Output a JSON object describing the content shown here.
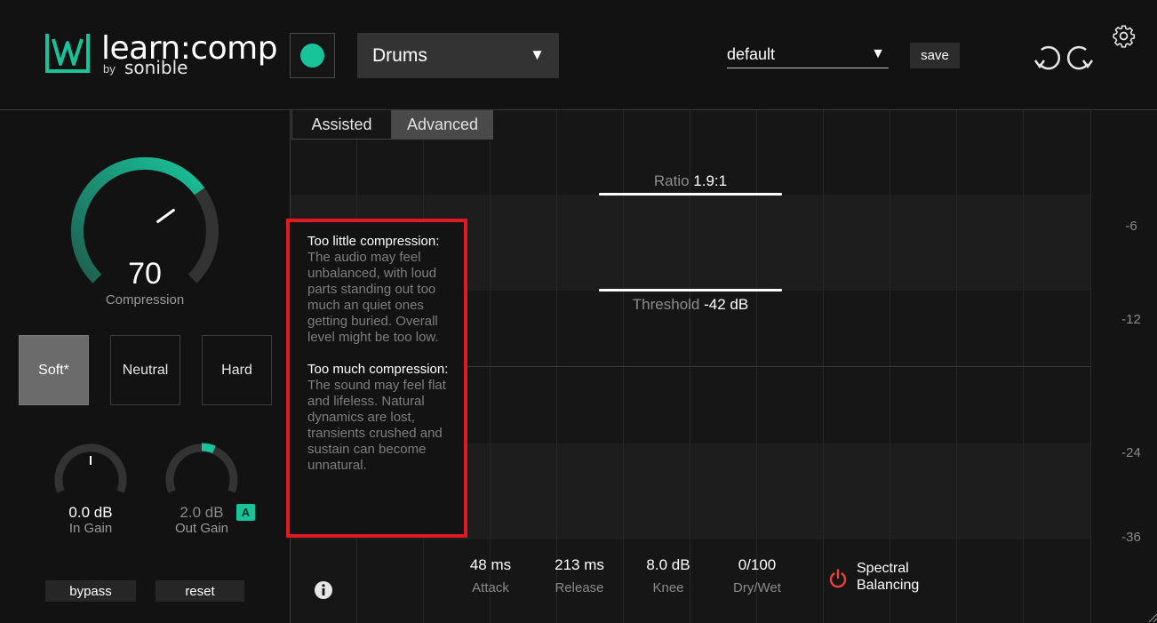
{
  "header": {
    "brand_name": "learn:comp",
    "brand_by": "by",
    "brand_company": "sonible",
    "instrument": "Drums",
    "preset": "default",
    "save_label": "save",
    "accent_color": "#19c39a"
  },
  "left_panel": {
    "compression_value": "70",
    "compression_label": "Compression",
    "compression_level": 0.7,
    "modes": [
      {
        "label": "Soft*",
        "active": true
      },
      {
        "label": "Neutral",
        "active": false
      },
      {
        "label": "Hard",
        "active": false
      }
    ],
    "in_gain": {
      "value": "0.0 dB",
      "label": "In Gain"
    },
    "out_gain": {
      "value": "2.0 dB",
      "label": "Out Gain",
      "auto_badge": "A"
    },
    "bypass_label": "bypass",
    "reset_label": "reset"
  },
  "graph": {
    "tabs": [
      {
        "label": "Assisted",
        "active": false
      },
      {
        "label": "Advanced",
        "active": true
      }
    ],
    "ratio": {
      "label": "Ratio",
      "value": "1.9:1"
    },
    "threshold": {
      "label": "Threshold",
      "value": "-42 dB"
    },
    "db_scale": [
      "-6",
      "-12",
      "-24",
      "-36"
    ],
    "params": [
      {
        "value": "48 ms",
        "label": "Attack"
      },
      {
        "value": "213 ms",
        "label": "Release"
      },
      {
        "value": "8.0 dB",
        "label": "Knee"
      },
      {
        "value": "0/100",
        "label": "Dry/Wet"
      }
    ],
    "spectral_label_line1": "Spectral",
    "spectral_label_line2": "Balancing",
    "power_color": "#e8423f"
  },
  "tooltip": {
    "heading1": "Too little compression:",
    "body1": "The audio may feel unbalanced, with loud parts standing out too much an quiet ones getting buried. Overall level might be too low.",
    "heading2": "Too much compression:",
    "body2": "The sound may feel flat and lifeless. Natural dynamics are lost, transients crushed and sustain can become unnatural.",
    "border_color": "#e01a22"
  }
}
